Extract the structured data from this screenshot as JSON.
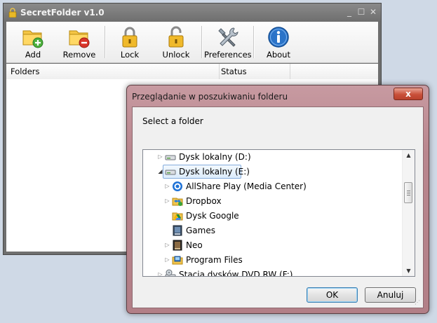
{
  "main_window": {
    "title": "SecretFolder v1.0",
    "controls": {
      "minimize": "_",
      "maximize": "☐",
      "close": "✕"
    },
    "toolbar": [
      {
        "label": "Add",
        "icon": "folder-add-icon"
      },
      {
        "label": "Remove",
        "icon": "folder-remove-icon"
      },
      {
        "label": "Lock",
        "icon": "padlock-closed-icon"
      },
      {
        "label": "Unlock",
        "icon": "padlock-open-icon"
      },
      {
        "label": "Preferences",
        "icon": "tools-icon"
      },
      {
        "label": "About",
        "icon": "info-icon"
      }
    ],
    "columns": [
      "Folders",
      "Status"
    ]
  },
  "dialog": {
    "title": "Przeglądanie w poszukiwaniu folderu",
    "close_label": "x",
    "prompt": "Select a folder",
    "tree": [
      {
        "label": "Dysk lokalny (D:)",
        "expander": "▷",
        "icon": "drive-icon"
      },
      {
        "label": "Dysk lokalny (E:)",
        "expander": "◢",
        "icon": "drive-icon",
        "selected": true
      },
      {
        "label": "AllShare Play (Media Center)",
        "expander": "▷",
        "icon": "allshare-icon"
      },
      {
        "label": "Dropbox",
        "expander": "▷",
        "icon": "dropbox-icon"
      },
      {
        "label": "Dysk Google",
        "expander": "",
        "icon": "google-drive-icon"
      },
      {
        "label": "Games",
        "expander": "",
        "icon": "games-folder-icon"
      },
      {
        "label": "Neo",
        "expander": "▷",
        "icon": "neo-folder-icon"
      },
      {
        "label": "Program Files",
        "expander": "▷",
        "icon": "program-files-icon"
      },
      {
        "label": "Stacja dysków DVD RW (F:)",
        "expander": "▷",
        "icon": "dvd-drive-icon"
      }
    ],
    "scroll": {
      "up": "▲",
      "down": "▼"
    },
    "ok_label": "OK",
    "cancel_label": "Anuluj"
  },
  "colors": {
    "dialog_frame": "#b9868e",
    "close_button": "#c9503a",
    "selection": "#dcecfc"
  }
}
